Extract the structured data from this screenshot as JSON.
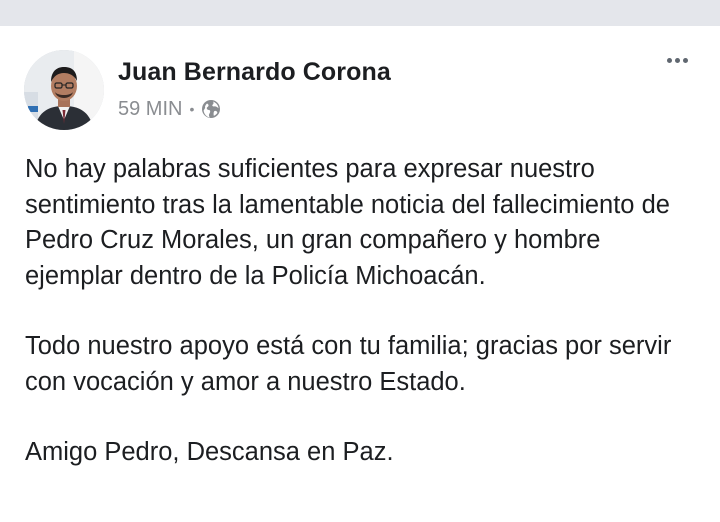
{
  "post": {
    "author_name": "Juan Bernardo Corona",
    "timestamp": "59 MIN",
    "separator": "•",
    "privacy_icon": "globe-icon",
    "more_icon": "more-options-icon",
    "paragraphs": [
      "No hay palabras suficientes para expresar nuestro sentimiento tras la lamentable noticia del fallecimiento de Pedro Cruz Morales, un gran compañero y hombre ejemplar dentro de la Policía Michoacán.",
      "Todo nuestro apoyo está con tu familia; gracias por servir con vocación y amor a nuestro Estado.",
      "Amigo Pedro, Descansa en Paz."
    ]
  },
  "colors": {
    "top_strip": "#e4e6eb",
    "text": "#1c1e21",
    "meta_text": "#8a8d91"
  }
}
